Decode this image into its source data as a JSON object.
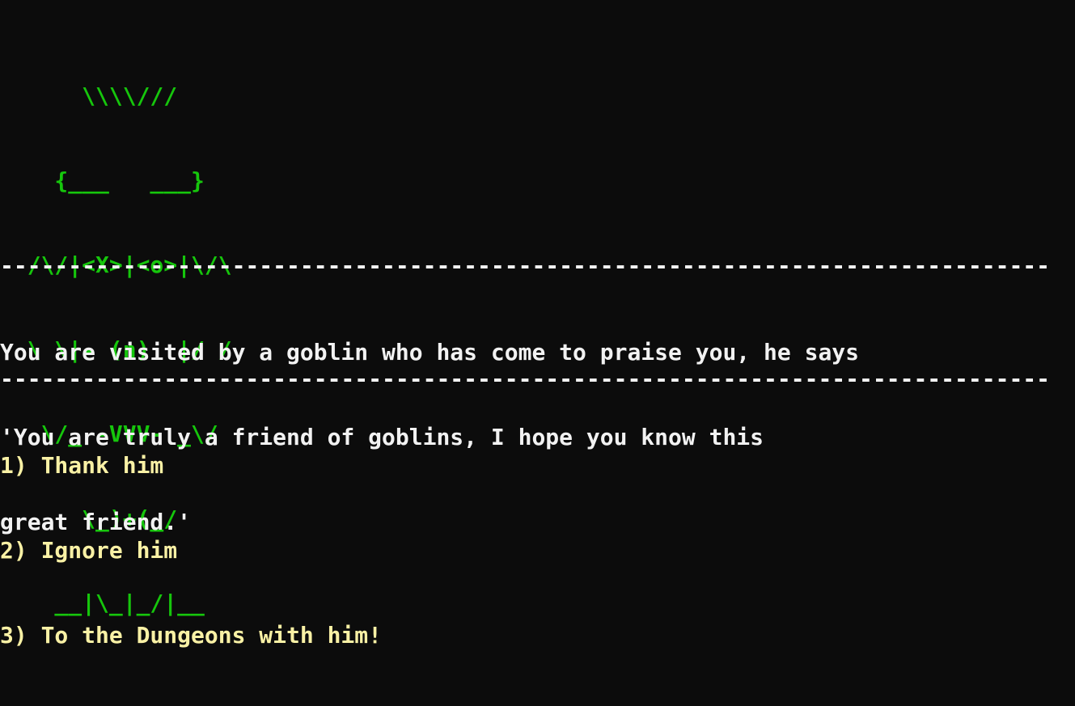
{
  "ascii_art": {
    "lines": [
      "      \\\\\\\\///",
      "    {___   ___}",
      "  /\\/|<X>|<o>|\\/\\",
      "  \\ \\|- (n)  |/ /",
      "   \\/_ -VVV- _\\/",
      "      \\_)+(_/",
      "    __|\\_|_/|__"
    ]
  },
  "divider": "-----------------------------------------------------------------------------",
  "message": {
    "lines": [
      "You are visited by a goblin who has come to praise you, he says",
      "'You are truly a friend of goblins, I hope you know this",
      "great friend.'"
    ]
  },
  "options": [
    {
      "label": "1) Thank him"
    },
    {
      "label": "2) Ignore him"
    },
    {
      "label": "3) To the Dungeons with him!"
    }
  ],
  "colors": {
    "background": "#0c0c0c",
    "art": "#16c60c",
    "text": "#f2f2f2",
    "options": "#f9f1a5"
  }
}
